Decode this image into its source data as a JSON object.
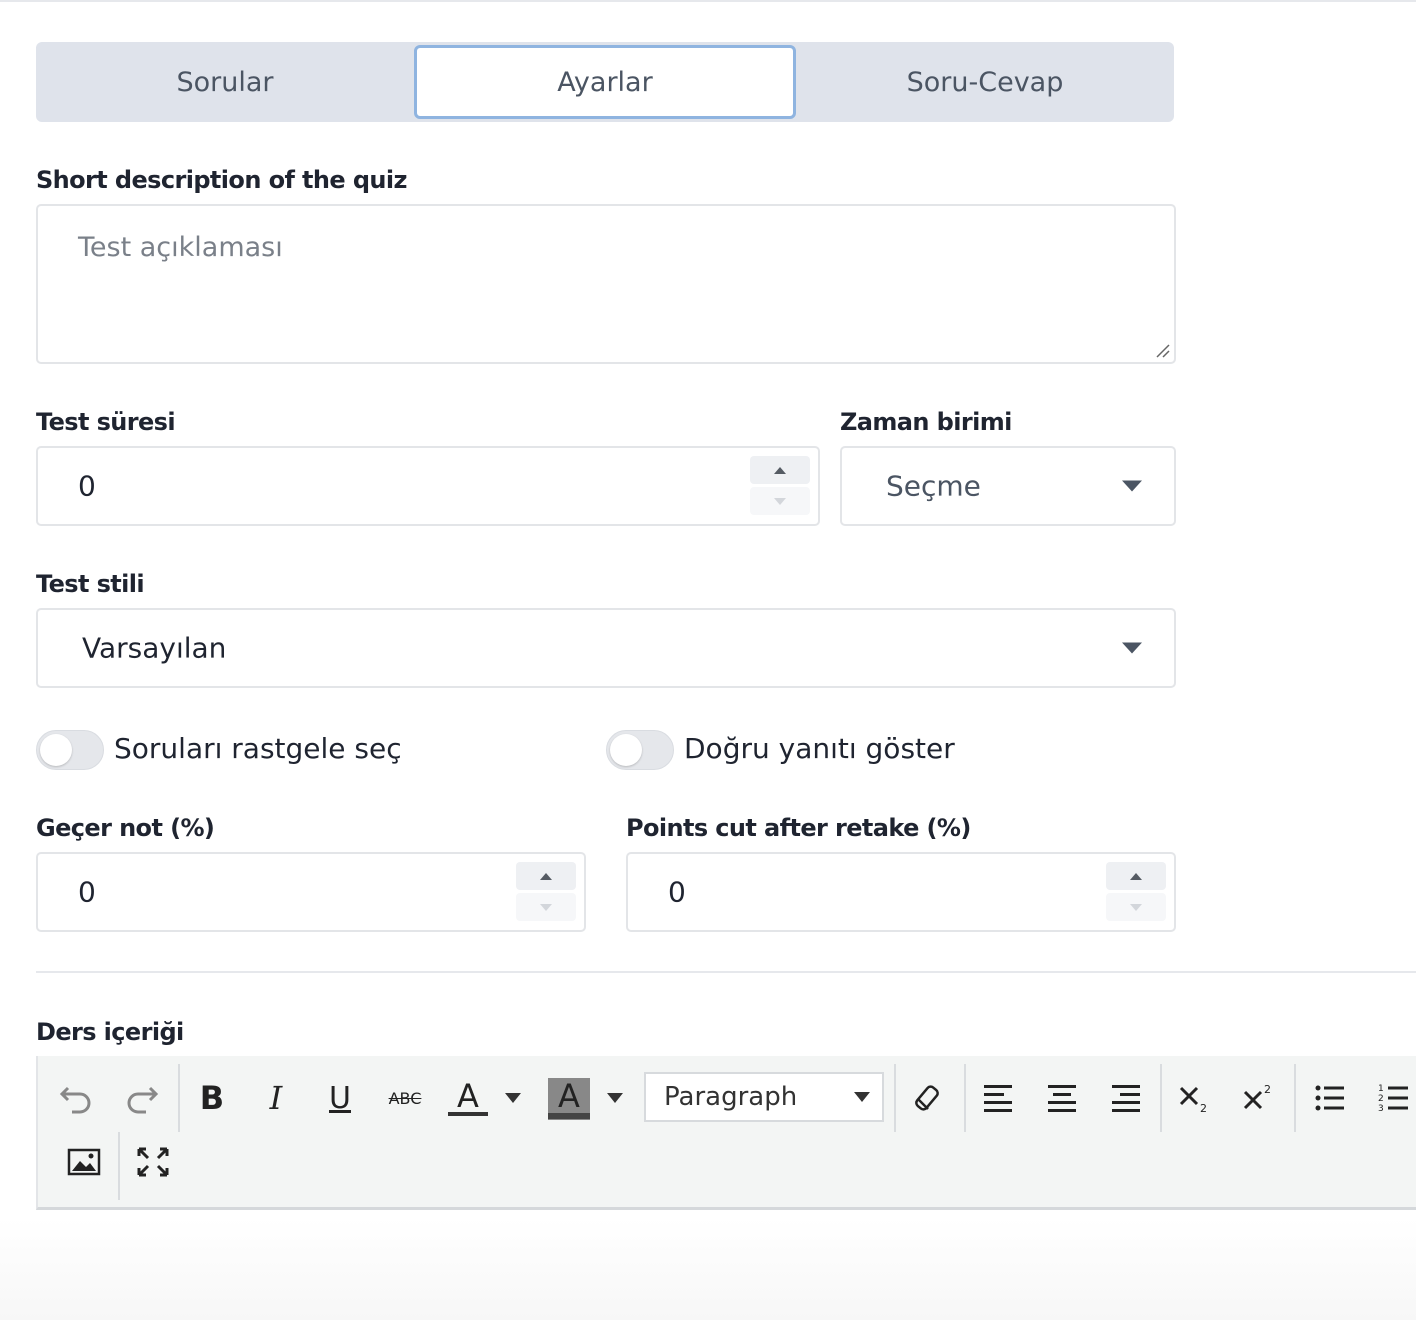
{
  "tabs": [
    "Sorular",
    "Ayarlar",
    "Soru-Cevap"
  ],
  "active_tab": "Ayarlar",
  "description": {
    "label": "Short description of the quiz",
    "placeholder": "Test açıklaması"
  },
  "duration": {
    "label": "Test süresi",
    "value": "0"
  },
  "time_unit": {
    "label": "Zaman birimi",
    "value": "Seçme"
  },
  "style": {
    "label": "Test stili",
    "value": "Varsayılan"
  },
  "toggles": {
    "random": "Soruları rastgele seç",
    "show_correct": "Doğru yanıtı göster"
  },
  "pass_grade": {
    "label": "Geçer not (%)",
    "value": "0"
  },
  "retake_cut": {
    "label": "Points cut after retake (%)",
    "value": "0"
  },
  "content": {
    "label": "Ders içeriği"
  },
  "editor": {
    "block_format": "Paragraph",
    "bold": "B",
    "italic": "I",
    "underline": "U",
    "strike": "ABC",
    "font_color": "A",
    "bg_color": "A"
  },
  "colors": {
    "accent": "#8fb4e0",
    "tab_bg": "#dfe3eb"
  }
}
